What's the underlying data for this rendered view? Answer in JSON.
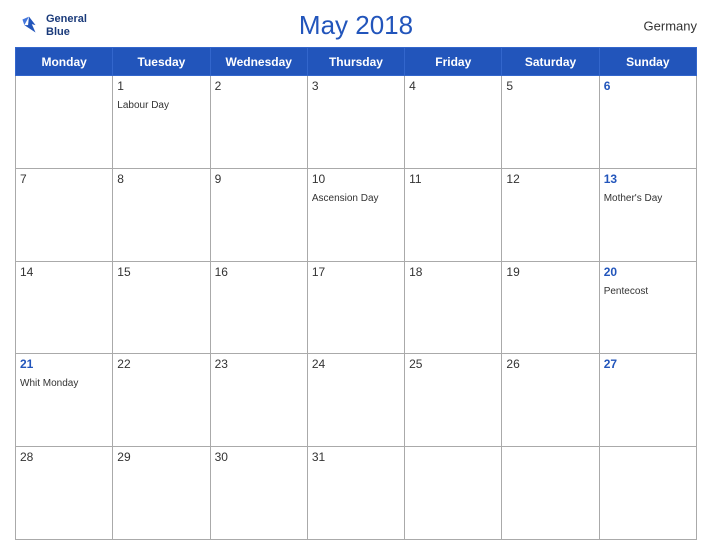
{
  "header": {
    "title": "May 2018",
    "country": "Germany",
    "logo_line1": "General",
    "logo_line2": "Blue"
  },
  "weekdays": [
    "Monday",
    "Tuesday",
    "Wednesday",
    "Thursday",
    "Friday",
    "Saturday",
    "Sunday"
  ],
  "weeks": [
    [
      {
        "day": "",
        "holiday": ""
      },
      {
        "day": "1",
        "holiday": "Labour Day"
      },
      {
        "day": "2",
        "holiday": ""
      },
      {
        "day": "3",
        "holiday": ""
      },
      {
        "day": "4",
        "holiday": ""
      },
      {
        "day": "5",
        "holiday": ""
      },
      {
        "day": "6",
        "holiday": ""
      }
    ],
    [
      {
        "day": "7",
        "holiday": ""
      },
      {
        "day": "8",
        "holiday": ""
      },
      {
        "day": "9",
        "holiday": ""
      },
      {
        "day": "10",
        "holiday": "Ascension Day"
      },
      {
        "day": "11",
        "holiday": ""
      },
      {
        "day": "12",
        "holiday": ""
      },
      {
        "day": "13",
        "holiday": "Mother's Day"
      }
    ],
    [
      {
        "day": "14",
        "holiday": ""
      },
      {
        "day": "15",
        "holiday": ""
      },
      {
        "day": "16",
        "holiday": ""
      },
      {
        "day": "17",
        "holiday": ""
      },
      {
        "day": "18",
        "holiday": ""
      },
      {
        "day": "19",
        "holiday": ""
      },
      {
        "day": "20",
        "holiday": "Pentecost"
      }
    ],
    [
      {
        "day": "21",
        "holiday": "Whit Monday"
      },
      {
        "day": "22",
        "holiday": ""
      },
      {
        "day": "23",
        "holiday": ""
      },
      {
        "day": "24",
        "holiday": ""
      },
      {
        "day": "25",
        "holiday": ""
      },
      {
        "day": "26",
        "holiday": ""
      },
      {
        "day": "27",
        "holiday": ""
      }
    ],
    [
      {
        "day": "28",
        "holiday": ""
      },
      {
        "day": "29",
        "holiday": ""
      },
      {
        "day": "30",
        "holiday": ""
      },
      {
        "day": "31",
        "holiday": ""
      },
      {
        "day": "",
        "holiday": ""
      },
      {
        "day": "",
        "holiday": ""
      },
      {
        "day": "",
        "holiday": ""
      }
    ]
  ]
}
